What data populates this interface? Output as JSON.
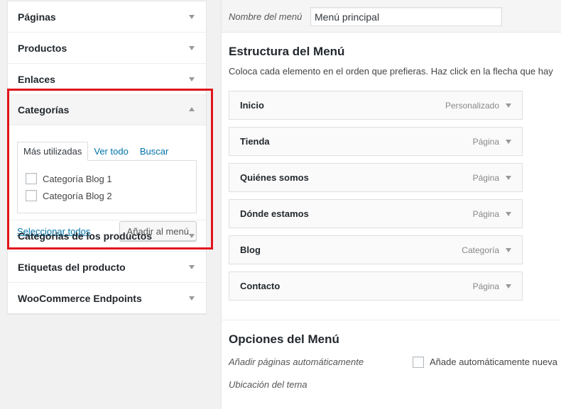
{
  "left_panel": {
    "sections": [
      {
        "label": "Páginas"
      },
      {
        "label": "Productos"
      },
      {
        "label": "Enlaces"
      },
      {
        "label": "Categorías"
      },
      {
        "label": "Categorias de los productos"
      },
      {
        "label": "Etiquetas del producto"
      },
      {
        "label": "WooCommerce Endpoints"
      }
    ],
    "categorias": {
      "tabs": [
        "Más utilizadas",
        "Ver todo",
        "Buscar"
      ],
      "items": [
        "Categoría Blog 1",
        "Categoría Blog 2"
      ],
      "select_all": "Seleccionar todos",
      "add_button": "Añadir al menú"
    }
  },
  "right_panel": {
    "menu_name_label": "Nombre del menú",
    "menu_name_value": "Menú principal",
    "structure_title": "Estructura del Menú",
    "structure_desc": "Coloca cada elemento en el orden que prefieras. Haz click en la flecha que hay",
    "menu_items": [
      {
        "title": "Inicio",
        "type": "Personalizado"
      },
      {
        "title": "Tienda",
        "type": "Página"
      },
      {
        "title": "Quiénes somos",
        "type": "Página"
      },
      {
        "title": "Dónde estamos",
        "type": "Página"
      },
      {
        "title": "Blog",
        "type": "Categoría"
      },
      {
        "title": "Contacto",
        "type": "Página"
      }
    ],
    "options_title": "Opciones del Menú",
    "auto_add_label": "Añadir páginas automáticamente",
    "auto_add_checkbox_label": "Añade automáticamente nueva",
    "theme_location_label": "Ubicación del tema"
  },
  "colors": {
    "highlight": "#e1141b",
    "link": "#0073aa"
  }
}
